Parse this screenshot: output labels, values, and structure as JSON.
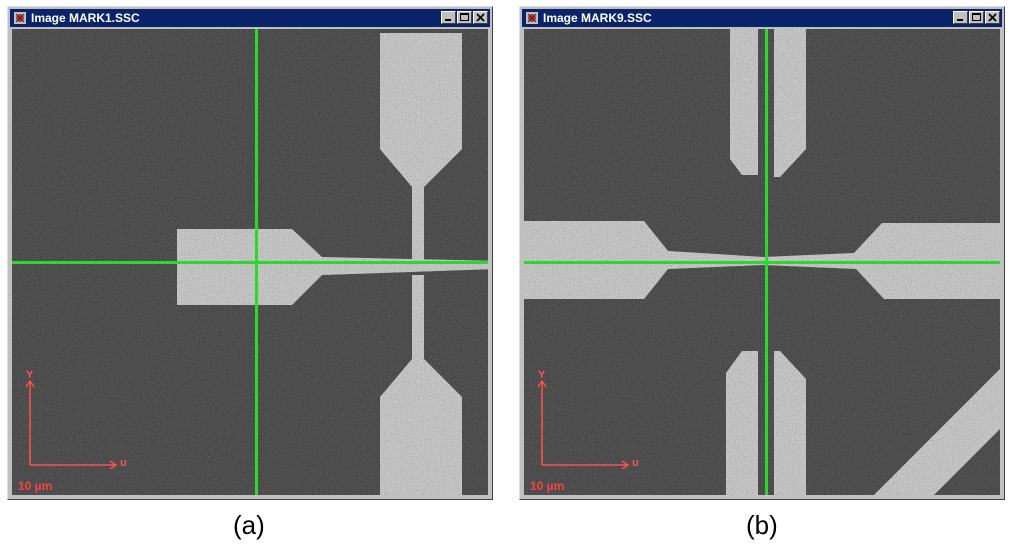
{
  "windows": [
    {
      "title": "Image MARK1.SSC",
      "axis_y_label": "Y",
      "axis_u_label": "u",
      "scale_label": "10 µm",
      "caption": "(a)"
    },
    {
      "title": "Image MARK9.SSC",
      "axis_y_label": "Y",
      "axis_u_label": "u",
      "scale_label": "10 µm",
      "caption": "(b)"
    }
  ],
  "icons": {
    "app": "app-icon",
    "minimize": "minimize-icon",
    "maximize": "maximize-icon",
    "close": "close-icon"
  },
  "colors": {
    "titlebar": "#0a246a",
    "crosshair": "#2bd82b",
    "axes": "#ff5050",
    "pattern": "#a8a8a8",
    "background": "#3c3c3c"
  }
}
